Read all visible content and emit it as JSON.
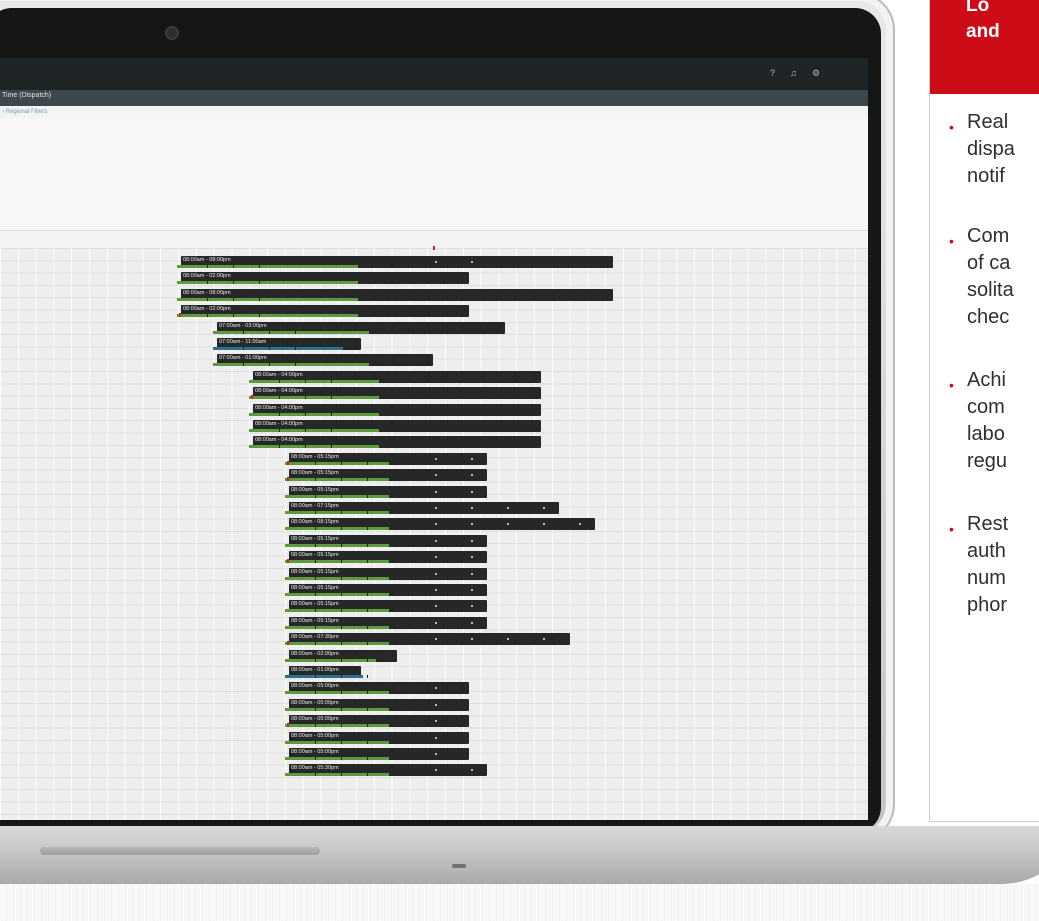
{
  "app": {
    "breadcrumb": "Time (Dispatch)",
    "filter_link": "› Regional Filters",
    "side_button_label": "load",
    "topbar_icons": [
      "question-icon",
      "bell-icon",
      "settings-icon"
    ]
  },
  "schedule": {
    "rows": [
      {
        "label": "08:00am - 08:00pm",
        "start": 0.0,
        "end": 12.0,
        "progress": 7.0,
        "dots": 2,
        "color": "green"
      },
      {
        "label": "08:00am - 02:00pm",
        "start": 0.0,
        "end": 8.0,
        "progress": 7.0,
        "dots": 0,
        "color": "green"
      },
      {
        "label": "08:00am - 08:00pm",
        "start": 0.0,
        "end": 12.0,
        "progress": 7.0,
        "dots": 0,
        "color": "green"
      },
      {
        "label": "08:00am - 02:00pm",
        "start": 0.0,
        "end": 8.0,
        "progress": 7.0,
        "dots": 0,
        "color": "green"
      },
      {
        "label": "07:00am - 03:00pm",
        "start": 1.0,
        "end": 9.0,
        "progress": 6.0,
        "dots": 0,
        "color": "green"
      },
      {
        "label": "07:00am - 11:00am",
        "start": 1.0,
        "end": 5.0,
        "progress": 5.0,
        "dots": 0,
        "color": "blue"
      },
      {
        "label": "07:00am - 01:00pm",
        "start": 1.0,
        "end": 7.0,
        "progress": 6.0,
        "dots": 0,
        "color": "green"
      },
      {
        "label": "08:00am - 04:00pm",
        "start": 2.0,
        "end": 10.0,
        "progress": 5.0,
        "dots": 0,
        "color": "green"
      },
      {
        "label": "08:00am - 04:00pm",
        "start": 2.0,
        "end": 10.0,
        "progress": 5.0,
        "dots": 0,
        "color": "green"
      },
      {
        "label": "08:00am - 04:00pm",
        "start": 2.0,
        "end": 10.0,
        "progress": 5.0,
        "dots": 0,
        "color": "green"
      },
      {
        "label": "08:00am - 04:00pm",
        "start": 2.0,
        "end": 10.0,
        "progress": 5.0,
        "dots": 0,
        "color": "green"
      },
      {
        "label": "08:00am - 04:00pm",
        "start": 2.0,
        "end": 10.0,
        "progress": 5.0,
        "dots": 0,
        "color": "green"
      },
      {
        "label": "08:00am - 05:15pm",
        "start": 3.0,
        "end": 8.5,
        "progress": 4.0,
        "dots": 5,
        "color": "green"
      },
      {
        "label": "08:00am - 05:15pm",
        "start": 3.0,
        "end": 8.5,
        "progress": 4.0,
        "dots": 5,
        "color": "green"
      },
      {
        "label": "08:00am - 05:15pm",
        "start": 3.0,
        "end": 8.5,
        "progress": 4.0,
        "dots": 5,
        "color": "green"
      },
      {
        "label": "08:00am - 07:15pm",
        "start": 3.0,
        "end": 10.5,
        "progress": 4.0,
        "dots": 6,
        "color": "green"
      },
      {
        "label": "08:00am - 08:15pm",
        "start": 3.0,
        "end": 11.5,
        "progress": 4.0,
        "dots": 7,
        "color": "green"
      },
      {
        "label": "08:00am - 05:15pm",
        "start": 3.0,
        "end": 8.5,
        "progress": 4.0,
        "dots": 5,
        "color": "green"
      },
      {
        "label": "08:00am - 05:15pm",
        "start": 3.0,
        "end": 8.5,
        "progress": 4.0,
        "dots": 5,
        "color": "green"
      },
      {
        "label": "08:00am - 05:15pm",
        "start": 3.0,
        "end": 8.5,
        "progress": 4.0,
        "dots": 5,
        "color": "green"
      },
      {
        "label": "08:00am - 05:15pm",
        "start": 3.0,
        "end": 8.5,
        "progress": 4.0,
        "dots": 5,
        "color": "green"
      },
      {
        "label": "08:00am - 05:15pm",
        "start": 3.0,
        "end": 8.5,
        "progress": 4.0,
        "dots": 5,
        "color": "green"
      },
      {
        "label": "08:00am - 05:15pm",
        "start": 3.0,
        "end": 8.5,
        "progress": 4.0,
        "dots": 5,
        "color": "green"
      },
      {
        "label": "08:00am - 07:30pm",
        "start": 3.0,
        "end": 10.8,
        "progress": 4.0,
        "dots": 6,
        "color": "green"
      },
      {
        "label": "08:00am - 02:00pm",
        "start": 3.0,
        "end": 6.0,
        "progress": 3.5,
        "dots": 0,
        "color": "green"
      },
      {
        "label": "08:00am - 01:00pm",
        "start": 3.0,
        "end": 5.0,
        "progress": 3.0,
        "dots": 0,
        "color": "blue"
      },
      {
        "label": "08:00am - 05:00pm",
        "start": 3.0,
        "end": 8.0,
        "progress": 4.0,
        "dots": 4,
        "color": "green"
      },
      {
        "label": "08:00am - 05:00pm",
        "start": 3.0,
        "end": 8.0,
        "progress": 4.0,
        "dots": 4,
        "color": "green"
      },
      {
        "label": "08:00am - 05:00pm",
        "start": 3.0,
        "end": 8.0,
        "progress": 4.0,
        "dots": 4,
        "color": "green"
      },
      {
        "label": "08:00am - 05:00pm",
        "start": 3.0,
        "end": 8.0,
        "progress": 4.0,
        "dots": 4,
        "color": "green"
      },
      {
        "label": "08:00am - 05:00pm",
        "start": 3.0,
        "end": 8.0,
        "progress": 4.0,
        "dots": 4,
        "color": "green"
      },
      {
        "label": "08:00am - 05:30pm",
        "start": 3.0,
        "end": 8.5,
        "progress": 4.0,
        "dots": 4,
        "color": "green"
      }
    ]
  },
  "panel": {
    "title": "Lo\nand",
    "bullets": [
      "Real\ndispa\nnotif",
      "Com\nof ca\nsolita\nchec",
      "Achi\ncom\nlabo\nregu",
      "Rest\nauth\nnum\nphor"
    ],
    "accent_color": "#cc0c16"
  },
  "colors": {
    "bar_dark": "#262828",
    "progress_green": "#5d9a3b",
    "progress_blue": "#2d6f8f",
    "topbar": "#1f2427"
  }
}
